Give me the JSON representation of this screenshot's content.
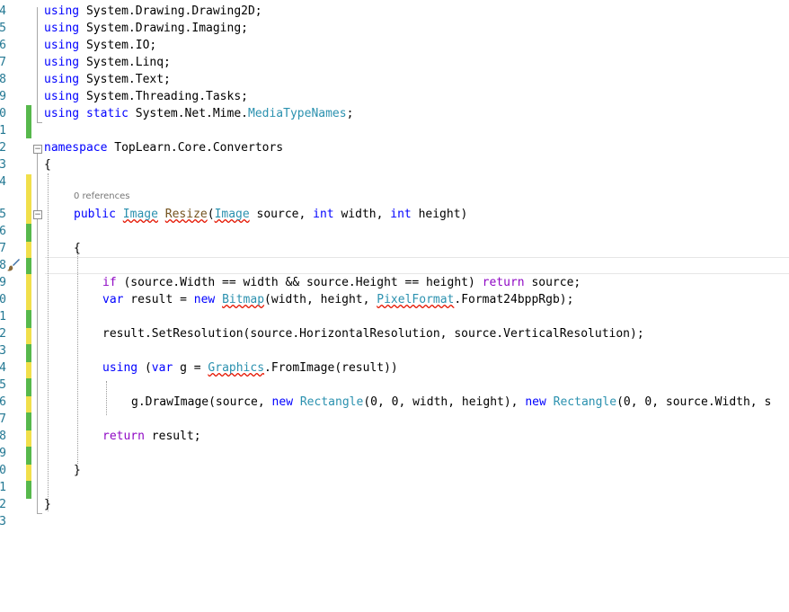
{
  "editor": {
    "codelens_label": "0 references",
    "line_numbers": [
      "4",
      "5",
      "6",
      "7",
      "8",
      "9",
      "0",
      "1",
      "2",
      "3",
      "4",
      "5",
      "6",
      "7",
      "8",
      "9",
      "0",
      "1",
      "2",
      "3",
      "4",
      "5",
      "6",
      "7",
      "8",
      "9",
      "0",
      "1",
      "2",
      "3"
    ],
    "lines": {
      "l1": {
        "kw": "using",
        "rest": " System.Drawing.Drawing2D;"
      },
      "l2": {
        "kw": "using",
        "rest": " System.Drawing.Imaging;"
      },
      "l3": {
        "kw": "using",
        "rest": " System.IO;"
      },
      "l4": {
        "kw": "using",
        "rest": " System.Linq;"
      },
      "l5": {
        "kw": "using",
        "rest": " System.Text;"
      },
      "l6": {
        "kw": "using",
        "rest": " System.Threading.Tasks;"
      },
      "l7": {
        "kw": "using",
        "kw_b": "static",
        "rest": " System.Net.Mime.",
        "type": "MediaTypeNames",
        "end": ";"
      },
      "l8": {
        "kw": "namespace",
        "rest": " TopLearn.Core.Convertors"
      },
      "l9": {
        "text": "{"
      },
      "l10": {
        "kw1": "public",
        "t1": "Image",
        "name": "Resize",
        "p1": "(",
        "t2": "Image",
        "p2": " source, ",
        "kw2": "int",
        "p3": " width, ",
        "kw3": "int",
        "p4": " height)"
      },
      "l11": {
        "text": "{"
      },
      "l12": {
        "kw": "if",
        "a": " (source.Width == width && source.Height == height) ",
        "kw2": "return",
        "b": " source;"
      },
      "l13": {
        "kw": "var",
        "a": " result = ",
        "kw2": "new",
        "sp": " ",
        "t1": "Bitmap",
        "b": "(width, height, ",
        "t2": "PixelFormat",
        "c": ".Format24bppRgb);"
      },
      "l14": {
        "text": "result.SetResolution(source.HorizontalResolution, source.VerticalResolution);"
      },
      "l15": {
        "kw": "using",
        "a": " (",
        "kw2": "var",
        "b": " g = ",
        "t1": "Graphics",
        "c": ".FromImage(result))"
      },
      "l16": {
        "a": "g.DrawImage(source, ",
        "kw1": "new",
        "sp1": " ",
        "t1": "Rectangle",
        "b": "(0, 0, width, height), ",
        "kw2": "new",
        "sp2": " ",
        "t2": "Rectangle",
        "c": "(0, 0, source.Width, s"
      },
      "l17": {
        "kw": "return",
        "rest": " result;"
      },
      "l18": {
        "text": "}"
      },
      "l19": {
        "text": "}"
      }
    },
    "colors": {
      "keyword": "#0000ff",
      "control_keyword": "#8f08c4",
      "type": "#2b91af",
      "line_number": "#237893",
      "gutter_saved": "#57b84c",
      "gutter_unsaved": "#f1df4b",
      "squiggle": "#e51400"
    },
    "icons": [
      "fold-minus-icon",
      "paintbrush-icon"
    ]
  }
}
